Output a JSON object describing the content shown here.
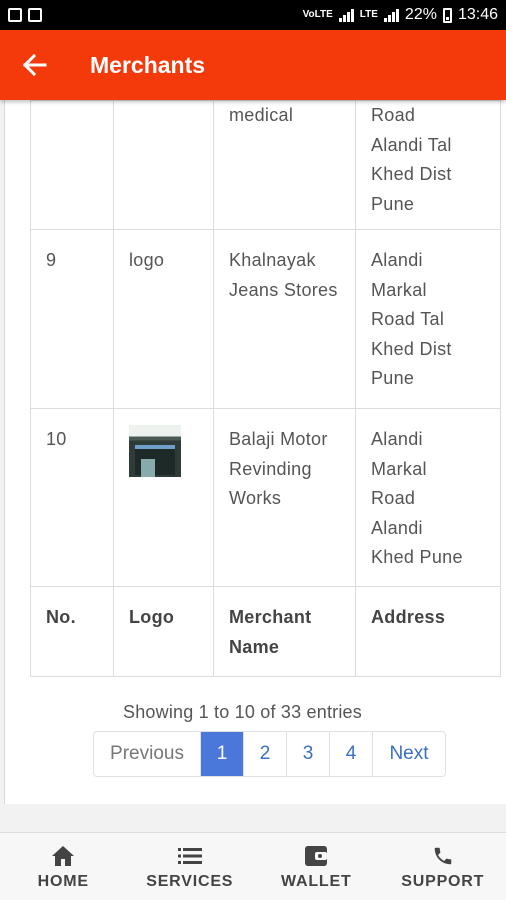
{
  "status_bar": {
    "network_label": "VoLTE",
    "lte_label": "LTE",
    "battery_percent": "22%",
    "time": "13:46"
  },
  "app_bar": {
    "title": "Merchants"
  },
  "table": {
    "partial_row": {
      "merchant_name": "medical",
      "address": "Road\nAlandi Tal\nKhed Dist\nPune"
    },
    "rows": [
      {
        "no": "9",
        "logo_alt": "logo",
        "merchant_name": "Khalnayak\nJeans Stores",
        "address": "Alandi\nMarkal\nRoad Tal\nKhed Dist\nPune"
      },
      {
        "no": "10",
        "logo_alt": "",
        "merchant_name": "Balaji Motor\nRevinding\nWorks",
        "address": "Alandi\nMarkal\nRoad\nAlandi\nKhed Pune"
      }
    ],
    "footer": {
      "no": "No.",
      "logo": "Logo",
      "merchant_name": "Merchant\nName",
      "address": "Address"
    }
  },
  "showing_text": "Showing 1 to 10 of 33 entries",
  "pagination": {
    "previous": "Previous",
    "pages": [
      "1",
      "2",
      "3",
      "4"
    ],
    "active_page": "1",
    "next": "Next"
  },
  "bottom_nav": [
    {
      "label": "HOME",
      "icon": "home-icon"
    },
    {
      "label": "SERVICES",
      "icon": "list-icon"
    },
    {
      "label": "WALLET",
      "icon": "wallet-icon"
    },
    {
      "label": "SUPPORT",
      "icon": "phone-icon"
    }
  ],
  "colors": {
    "app_bar": "#f4390b",
    "active_page": "#4a77d9",
    "link": "#3a6fc4"
  }
}
